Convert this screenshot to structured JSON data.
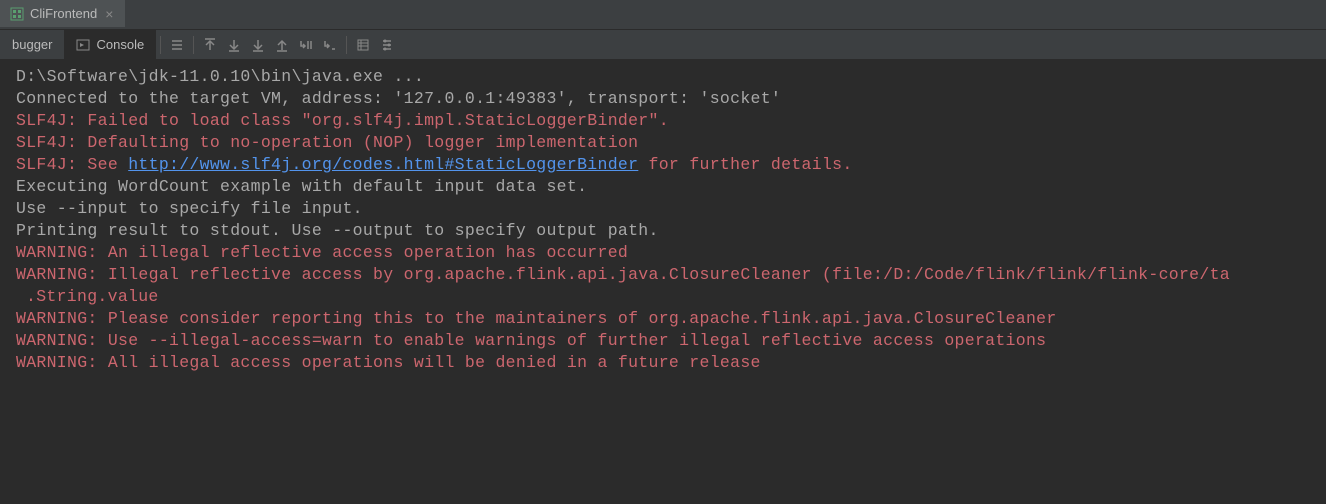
{
  "tab": {
    "title": "CliFrontend"
  },
  "toolbar": {
    "debugger_label": "bugger",
    "console_label": "Console"
  },
  "console": {
    "lines": [
      {
        "text": "D:\\Software\\jdk-11.0.10\\bin\\java.exe ...",
        "type": "normal"
      },
      {
        "text": "Connected to the target VM, address: '127.0.0.1:49383', transport: 'socket'",
        "type": "normal"
      },
      {
        "text": "SLF4J: Failed to load class \"org.slf4j.impl.StaticLoggerBinder\".",
        "type": "red"
      },
      {
        "text": "SLF4J: Defaulting to no-operation (NOP) logger implementation",
        "type": "red"
      },
      {
        "prefix": "SLF4J: See ",
        "link": "http://www.slf4j.org/codes.html#StaticLoggerBinder",
        "suffix": " for further details.",
        "type": "red-link"
      },
      {
        "text": "Executing WordCount example with default input data set.",
        "type": "normal"
      },
      {
        "text": "Use --input to specify file input.",
        "type": "normal"
      },
      {
        "text": "Printing result to stdout. Use --output to specify output path.",
        "type": "normal"
      },
      {
        "text": "WARNING: An illegal reflective access operation has occurred",
        "type": "red"
      },
      {
        "text": "WARNING: Illegal reflective access by org.apache.flink.api.java.ClosureCleaner (file:/D:/Code/flink/flink/flink-core/ta",
        "type": "red"
      },
      {
        "text": ".String.value",
        "type": "red",
        "indent": true
      },
      {
        "text": "WARNING: Please consider reporting this to the maintainers of org.apache.flink.api.java.ClosureCleaner",
        "type": "red"
      },
      {
        "text": "WARNING: Use --illegal-access=warn to enable warnings of further illegal reflective access operations",
        "type": "red"
      },
      {
        "text": "WARNING: All illegal access operations will be denied in a future release",
        "type": "red"
      }
    ]
  }
}
